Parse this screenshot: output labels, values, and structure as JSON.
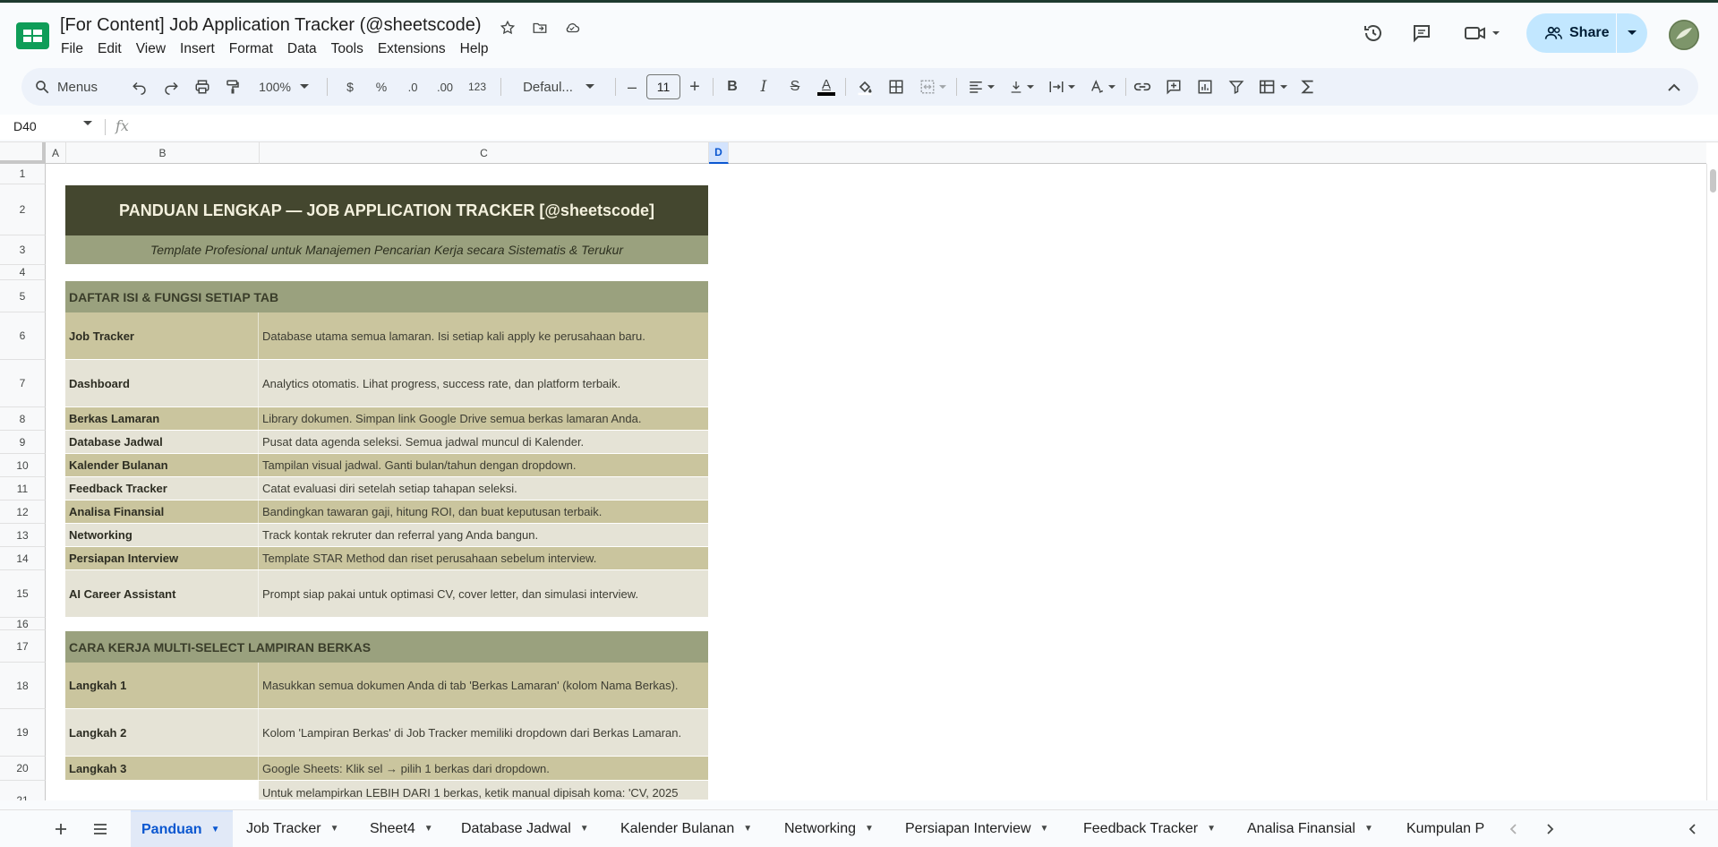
{
  "app": {
    "doc_title": "[For Content] Job Application Tracker (@sheetscode)",
    "menu": [
      "File",
      "Edit",
      "View",
      "Insert",
      "Format",
      "Data",
      "Tools",
      "Extensions",
      "Help"
    ],
    "share_label": "Share"
  },
  "toolbar": {
    "menus_label": "Menus",
    "zoom": "100%",
    "currency": "$",
    "percent": "%",
    "dec_decrease": ".0",
    "dec_increase": ".00",
    "number_format": "123",
    "font": "Defaul...",
    "font_size": "11",
    "minus": "–",
    "plus": "+",
    "bold": "B",
    "italic": "I",
    "strike": "S",
    "text_color_letter": "A"
  },
  "formula_bar": {
    "cell_ref": "D40",
    "fx": "fx"
  },
  "columns": [
    "A",
    "B",
    "C",
    "D"
  ],
  "rows": [
    "1",
    "2",
    "3",
    "4",
    "5",
    "6",
    "7",
    "8",
    "9",
    "10",
    "11",
    "12",
    "13",
    "14",
    "15",
    "16",
    "17",
    "18",
    "19",
    "20",
    "21"
  ],
  "sheet": {
    "title": "PANDUAN LENGKAP — JOB APPLICATION TRACKER [@sheetscode]",
    "subtitle": "Template Profesional untuk Manajemen Pencarian Kerja secara Sistematis & Terukur",
    "section1": "DAFTAR ISI & FUNGSI SETIAP TAB",
    "items1": [
      {
        "k": "Job Tracker",
        "v": "Database utama semua lamaran. Isi setiap kali apply ke perusahaan baru."
      },
      {
        "k": "Dashboard",
        "v": "Analytics otomatis. Lihat progress, success rate, dan platform terbaik."
      },
      {
        "k": "Berkas Lamaran",
        "v": "Library dokumen. Simpan link Google Drive semua berkas lamaran Anda."
      },
      {
        "k": "Database Jadwal",
        "v": "Pusat data agenda seleksi. Semua jadwal muncul di Kalender."
      },
      {
        "k": "Kalender Bulanan",
        "v": "Tampilan visual jadwal. Ganti bulan/tahun dengan dropdown."
      },
      {
        "k": "Feedback Tracker",
        "v": "Catat evaluasi diri setelah setiap tahapan seleksi."
      },
      {
        "k": "Analisa Finansial",
        "v": "Bandingkan tawaran gaji, hitung ROI, dan buat keputusan terbaik."
      },
      {
        "k": "Networking",
        "v": "Track kontak rekruter dan referral yang Anda bangun."
      },
      {
        "k": "Persiapan Interview",
        "v": "Template STAR Method dan riset perusahaan sebelum interview."
      },
      {
        "k": "AI Career Assistant",
        "v": "Prompt siap pakai untuk optimasi CV, cover letter, dan simulasi interview."
      }
    ],
    "section2": "CARA KERJA MULTI-SELECT LAMPIRAN BERKAS",
    "items2": [
      {
        "k": "Langkah 1",
        "v": "Masukkan semua dokumen Anda di tab 'Berkas Lamaran' (kolom Nama Berkas)."
      },
      {
        "k": "Langkah 2",
        "v": "Kolom 'Lampiran Berkas' di Job Tracker memiliki dropdown dari Berkas Lamaran."
      },
      {
        "k": "Langkah 3",
        "v": "Google Sheets: Klik sel → pilih 1 berkas dari dropdown."
      },
      {
        "k": "",
        "v": "Untuk melampirkan LEBIH DARI 1 berkas, ketik manual dipisah koma: 'CV, 2025"
      }
    ]
  },
  "tabs": [
    "Panduan",
    "Job Tracker",
    "Sheet4",
    "Database Jadwal",
    "Kalender Bulanan",
    "Networking",
    "Persiapan Interview",
    "Feedback Tracker",
    "Analisa Finansial",
    "Kumpulan P"
  ],
  "colors": {
    "banner_dark": "#44472f",
    "banner_light": "#9aa17e",
    "row_a": "#cac59e",
    "row_b": "#e5e3d6",
    "accent": "#0b57d0",
    "share_bg": "#c2e7ff"
  }
}
